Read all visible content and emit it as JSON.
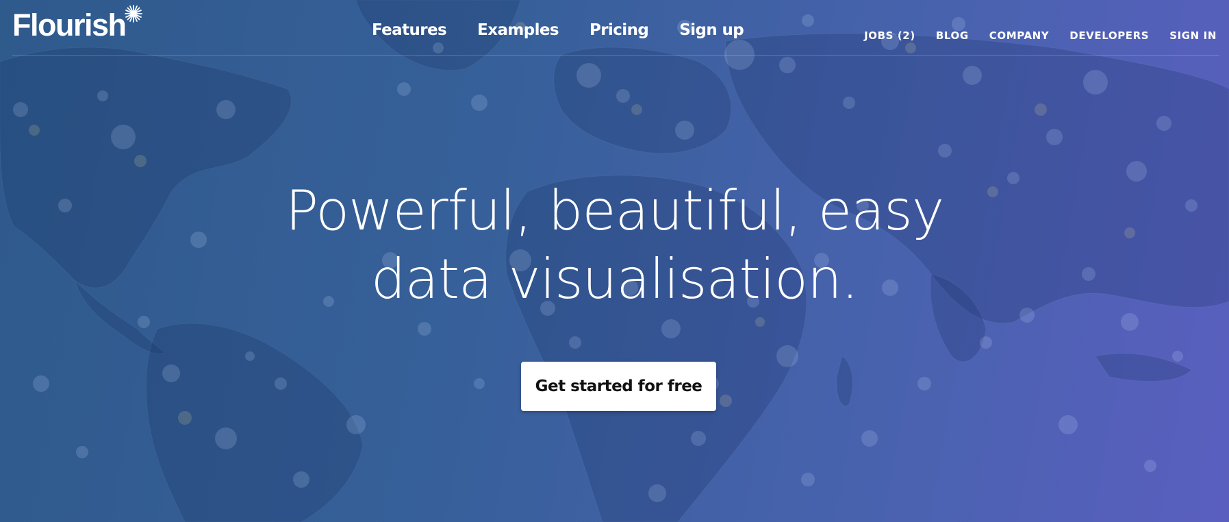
{
  "brand": {
    "name": "Flourish",
    "logo_icon": "sparkle-icon"
  },
  "main_nav": [
    {
      "label": "Features"
    },
    {
      "label": "Examples"
    },
    {
      "label": "Pricing"
    },
    {
      "label": "Sign up"
    }
  ],
  "utility_nav": [
    {
      "label": "JOBS (2)"
    },
    {
      "label": "BLOG"
    },
    {
      "label": "COMPANY"
    },
    {
      "label": "DEVELOPERS"
    },
    {
      "label": "SIGN IN"
    }
  ],
  "hero": {
    "headline_line1": "Powerful, beautiful, easy",
    "headline_line2": "data visualisation.",
    "cta_label": "Get started for free"
  },
  "colors": {
    "background_start": "#2f5a8c",
    "background_end": "#5a5fbf",
    "text": "#ffffff",
    "button_bg": "#ffffff",
    "button_text": "#111111"
  },
  "background": {
    "image": "world-map-with-data-dots"
  }
}
